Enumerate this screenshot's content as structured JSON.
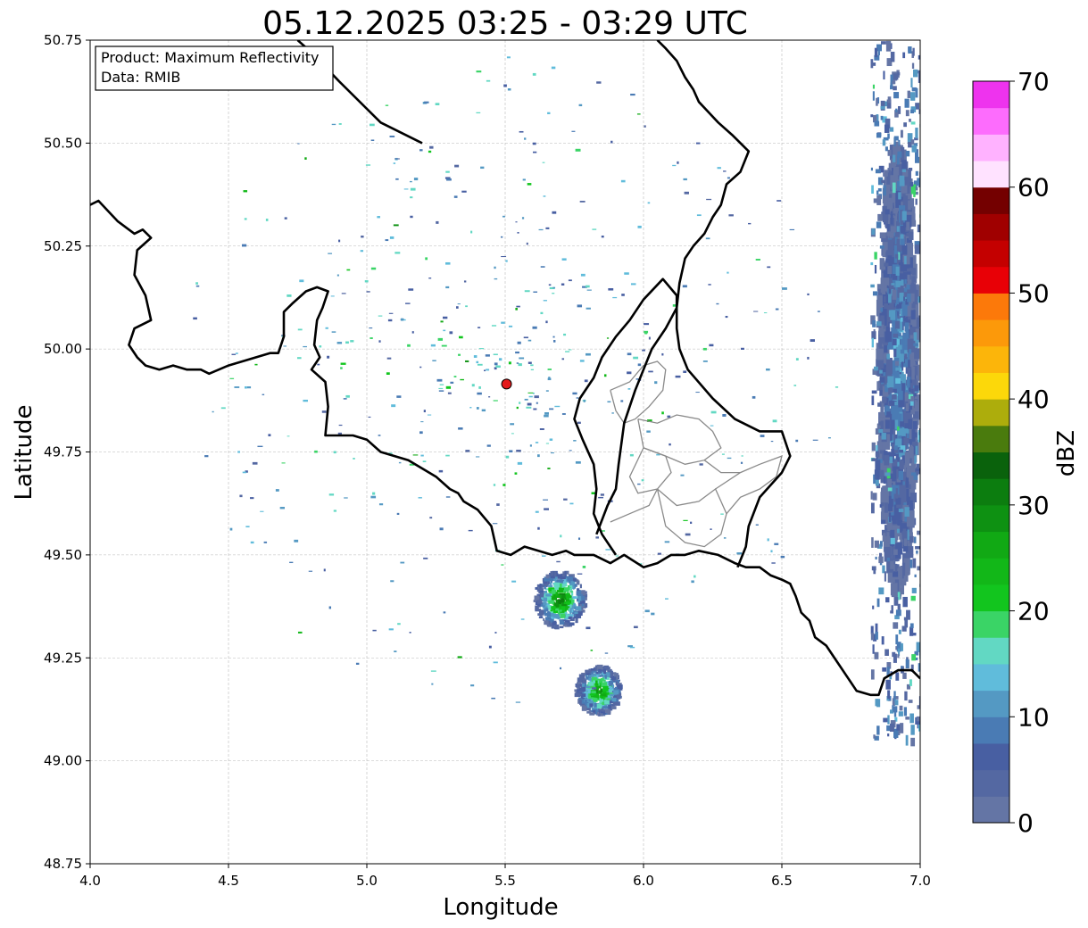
{
  "title": "05.12.2025 03:25 - 03:29 UTC",
  "info_box": {
    "product": "Product: Maximum Reflectivity",
    "data": "Data: RMIB"
  },
  "axes": {
    "xlabel": "Longitude",
    "ylabel": "Latitude",
    "xlim": [
      4.0,
      7.0
    ],
    "ylim": [
      48.75,
      50.75
    ],
    "xticks": [
      "4.0",
      "4.5",
      "5.0",
      "5.5",
      "6.0",
      "6.5",
      "7.0"
    ],
    "yticks": [
      "48.75",
      "49.00",
      "49.25",
      "49.50",
      "49.75",
      "50.00",
      "50.25",
      "50.50",
      "50.75"
    ],
    "grid": true
  },
  "colorbar": {
    "label": "dBZ",
    "ticks": [
      "0",
      "10",
      "20",
      "30",
      "40",
      "50",
      "60",
      "70"
    ],
    "range": [
      0,
      70
    ],
    "step": 2.5,
    "colors": [
      "#6475a5",
      "#5468a2",
      "#485fa2",
      "#4a7bb4",
      "#5499c3",
      "#60bcdb",
      "#62d8c3",
      "#3ad466",
      "#12c51e",
      "#12b718",
      "#11a914",
      "#0e9112",
      "#0c7d0f",
      "#0a620c",
      "#4a7b0d",
      "#adad0c",
      "#fcd80a",
      "#fcb50a",
      "#fc990a",
      "#fc790a",
      "#e80006",
      "#c40000",
      "#a00000",
      "#740000",
      "#ffe2ff",
      "#ffb2ff",
      "#fd6cfd",
      "#ee33ee"
    ]
  },
  "radar_site": {
    "lon": 5.505,
    "lat": 49.915,
    "color": "#e41a1c"
  },
  "precip_cells": [
    {
      "lon": 5.7,
      "lat": 49.39,
      "dlon": 0.09,
      "dlat": 0.07,
      "max_dbz": 32
    },
    {
      "lon": 5.84,
      "lat": 49.17,
      "dlon": 0.08,
      "dlat": 0.06,
      "max_dbz": 30
    },
    {
      "lon": 6.92,
      "lat": 49.95,
      "dlon": 0.07,
      "dlat": 0.55,
      "max_dbz": 12
    }
  ],
  "borders": {
    "north": [
      [
        4.75,
        50.75
      ],
      [
        4.8,
        50.72
      ],
      [
        4.9,
        50.65
      ],
      [
        5.05,
        50.55
      ],
      [
        5.2,
        50.5
      ]
    ],
    "national": [
      [
        4.0,
        50.35
      ],
      [
        4.03,
        50.36
      ],
      [
        4.1,
        50.31
      ],
      [
        4.16,
        50.28
      ],
      [
        4.19,
        50.29
      ],
      [
        4.22,
        50.27
      ],
      [
        4.17,
        50.24
      ],
      [
        4.16,
        50.18
      ],
      [
        4.2,
        50.13
      ],
      [
        4.22,
        50.07
      ],
      [
        4.16,
        50.05
      ],
      [
        4.14,
        50.01
      ],
      [
        4.17,
        49.98
      ],
      [
        4.2,
        49.96
      ],
      [
        4.25,
        49.95
      ],
      [
        4.3,
        49.96
      ],
      [
        4.35,
        49.95
      ],
      [
        4.4,
        49.95
      ],
      [
        4.43,
        49.94
      ],
      [
        4.5,
        49.96
      ],
      [
        4.55,
        49.97
      ],
      [
        4.6,
        49.98
      ],
      [
        4.65,
        49.99
      ],
      [
        4.68,
        49.99
      ],
      [
        4.7,
        50.03
      ],
      [
        4.7,
        50.09
      ],
      [
        4.73,
        50.11
      ],
      [
        4.78,
        50.14
      ],
      [
        4.82,
        50.15
      ],
      [
        4.86,
        50.14
      ],
      [
        4.84,
        50.1
      ],
      [
        4.82,
        50.07
      ],
      [
        4.81,
        50.01
      ],
      [
        4.83,
        49.98
      ],
      [
        4.8,
        49.95
      ],
      [
        4.85,
        49.92
      ],
      [
        4.86,
        49.86
      ],
      [
        4.85,
        49.79
      ],
      [
        4.9,
        49.79
      ],
      [
        4.95,
        49.79
      ],
      [
        5.0,
        49.78
      ],
      [
        5.05,
        49.75
      ],
      [
        5.1,
        49.74
      ],
      [
        5.15,
        49.73
      ],
      [
        5.2,
        49.71
      ],
      [
        5.25,
        49.69
      ],
      [
        5.3,
        49.66
      ],
      [
        5.33,
        49.65
      ],
      [
        5.35,
        49.63
      ],
      [
        5.4,
        49.61
      ],
      [
        5.45,
        49.57
      ],
      [
        5.47,
        49.51
      ],
      [
        5.52,
        49.5
      ],
      [
        5.57,
        49.52
      ],
      [
        5.62,
        49.51
      ],
      [
        5.67,
        49.5
      ],
      [
        5.72,
        49.51
      ],
      [
        5.75,
        49.5
      ],
      [
        5.82,
        49.5
      ],
      [
        5.88,
        49.48
      ],
      [
        5.93,
        49.5
      ],
      [
        6.0,
        49.47
      ],
      [
        6.05,
        49.48
      ],
      [
        6.1,
        49.5
      ],
      [
        6.15,
        49.5
      ],
      [
        6.2,
        49.51
      ],
      [
        6.27,
        49.5
      ],
      [
        6.33,
        49.48
      ],
      [
        6.37,
        49.47
      ],
      [
        6.42,
        49.47
      ],
      [
        6.46,
        49.45
      ],
      [
        6.5,
        49.44
      ],
      [
        6.53,
        49.43
      ],
      [
        6.55,
        49.4
      ],
      [
        6.57,
        49.36
      ],
      [
        6.6,
        49.34
      ],
      [
        6.62,
        49.3
      ],
      [
        6.66,
        49.28
      ],
      [
        6.7,
        49.24
      ],
      [
        6.74,
        49.2
      ],
      [
        6.77,
        49.17
      ],
      [
        6.82,
        49.16
      ],
      [
        6.85,
        49.16
      ],
      [
        6.87,
        49.2
      ],
      [
        6.92,
        49.22
      ],
      [
        6.97,
        49.22
      ],
      [
        7.0,
        49.2
      ]
    ],
    "lux_east": [
      [
        5.83,
        49.55
      ],
      [
        5.87,
        49.62
      ],
      [
        5.9,
        49.66
      ],
      [
        5.91,
        49.72
      ],
      [
        5.92,
        49.77
      ],
      [
        5.93,
        49.82
      ],
      [
        5.95,
        49.86
      ],
      [
        5.97,
        49.9
      ],
      [
        6.0,
        49.95
      ],
      [
        6.03,
        50.0
      ],
      [
        6.08,
        50.05
      ],
      [
        6.12,
        50.1
      ],
      [
        6.13,
        50.16
      ],
      [
        6.15,
        50.22
      ],
      [
        6.18,
        50.25
      ],
      [
        6.22,
        50.28
      ],
      [
        6.25,
        50.32
      ],
      [
        6.28,
        50.35
      ],
      [
        6.3,
        50.4
      ],
      [
        6.35,
        50.43
      ],
      [
        6.38,
        50.48
      ],
      [
        6.32,
        50.52
      ],
      [
        6.27,
        50.55
      ],
      [
        6.2,
        50.6
      ],
      [
        6.18,
        50.63
      ],
      [
        6.15,
        50.66
      ],
      [
        6.12,
        50.7
      ],
      [
        6.08,
        50.73
      ],
      [
        6.05,
        50.75
      ]
    ],
    "lux_loop": [
      [
        5.9,
        49.5
      ],
      [
        5.85,
        49.55
      ],
      [
        5.82,
        49.6
      ],
      [
        5.83,
        49.66
      ],
      [
        5.82,
        49.72
      ],
      [
        5.78,
        49.78
      ],
      [
        5.75,
        49.83
      ],
      [
        5.77,
        49.88
      ],
      [
        5.82,
        49.93
      ],
      [
        5.85,
        49.98
      ],
      [
        5.9,
        50.03
      ],
      [
        5.95,
        50.07
      ],
      [
        6.0,
        50.12
      ],
      [
        6.07,
        50.17
      ],
      [
        6.12,
        50.13
      ],
      [
        6.12,
        50.05
      ],
      [
        6.13,
        50.0
      ],
      [
        6.16,
        49.95
      ],
      [
        6.25,
        49.88
      ],
      [
        6.33,
        49.83
      ],
      [
        6.42,
        49.8
      ],
      [
        6.5,
        49.8
      ],
      [
        6.53,
        49.74
      ],
      [
        6.5,
        49.7
      ],
      [
        6.42,
        49.64
      ],
      [
        6.38,
        49.57
      ],
      [
        6.37,
        49.52
      ],
      [
        6.34,
        49.47
      ]
    ]
  },
  "regions": [
    [
      [
        5.88,
        49.9
      ],
      [
        5.95,
        49.92
      ],
      [
        6.0,
        49.96
      ],
      [
        6.05,
        49.97
      ],
      [
        6.08,
        49.95
      ],
      [
        6.07,
        49.9
      ],
      [
        6.02,
        49.86
      ],
      [
        5.97,
        49.83
      ],
      [
        5.93,
        49.82
      ],
      [
        5.9,
        49.85
      ],
      [
        5.88,
        49.9
      ]
    ],
    [
      [
        5.98,
        49.83
      ],
      [
        6.05,
        49.82
      ],
      [
        6.12,
        49.84
      ],
      [
        6.2,
        49.83
      ],
      [
        6.25,
        49.8
      ],
      [
        6.28,
        49.76
      ],
      [
        6.22,
        49.73
      ],
      [
        6.15,
        49.72
      ],
      [
        6.08,
        49.74
      ],
      [
        6.0,
        49.76
      ],
      [
        5.98,
        49.83
      ]
    ],
    [
      [
        6.0,
        49.76
      ],
      [
        6.08,
        49.74
      ],
      [
        6.1,
        49.7
      ],
      [
        6.05,
        49.66
      ],
      [
        5.98,
        49.65
      ],
      [
        5.95,
        49.69
      ],
      [
        6.0,
        49.76
      ]
    ],
    [
      [
        6.05,
        49.66
      ],
      [
        6.12,
        49.62
      ],
      [
        6.2,
        49.63
      ],
      [
        6.26,
        49.66
      ],
      [
        6.3,
        49.6
      ],
      [
        6.28,
        49.55
      ],
      [
        6.22,
        49.52
      ],
      [
        6.15,
        49.53
      ],
      [
        6.08,
        49.57
      ],
      [
        6.05,
        49.66
      ]
    ],
    [
      [
        6.26,
        49.66
      ],
      [
        6.35,
        49.7
      ],
      [
        6.42,
        49.72
      ],
      [
        6.5,
        49.74
      ],
      [
        6.48,
        49.69
      ],
      [
        6.42,
        49.66
      ],
      [
        6.35,
        49.64
      ],
      [
        6.3,
        49.6
      ]
    ],
    [
      [
        5.88,
        49.58
      ],
      [
        5.95,
        49.6
      ],
      [
        6.02,
        49.62
      ],
      [
        6.05,
        49.66
      ]
    ],
    [
      [
        6.22,
        49.73
      ],
      [
        6.28,
        49.7
      ],
      [
        6.35,
        49.7
      ]
    ]
  ]
}
